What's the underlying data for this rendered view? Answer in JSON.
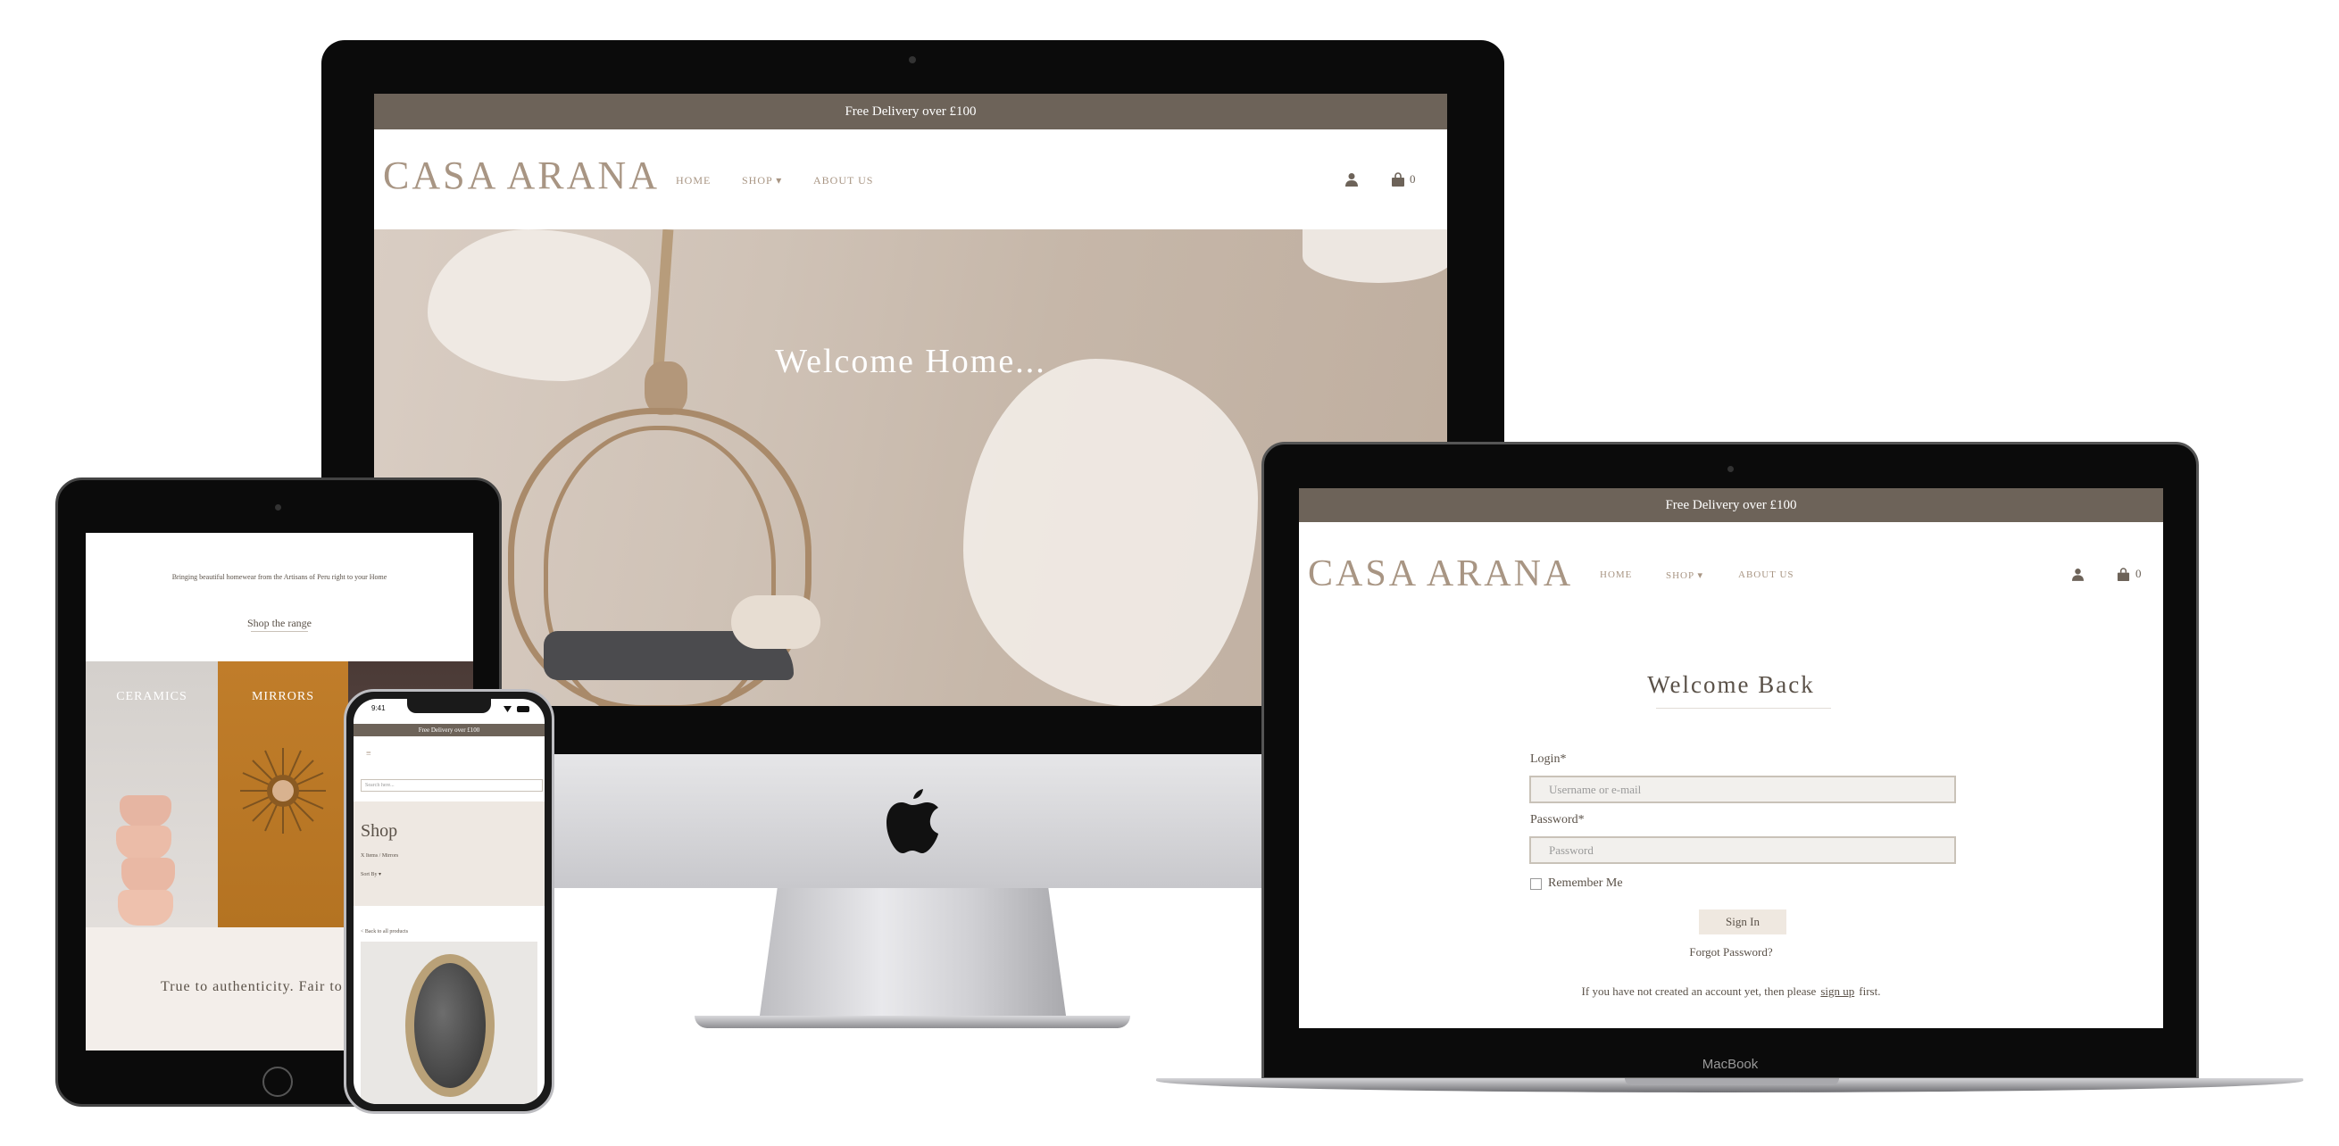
{
  "desktop": {
    "top_banner": "Free Delivery over £100",
    "logo": "CASA ARANA",
    "nav": {
      "home": "HOME",
      "shop": "SHOP",
      "about": "ABOUT US"
    },
    "cart_count": "0",
    "hero_title": "Welcome Home..."
  },
  "laptop": {
    "top_banner": "Free Delivery over £100",
    "logo": "CASA ARANA",
    "nav": {
      "home": "HOME",
      "shop": "SHOP",
      "about": "ABOUT US"
    },
    "cart_count": "0",
    "heading": "Welcome Back",
    "login_label": "Login*",
    "login_placeholder": "Username or e-mail",
    "password_label": "Password*",
    "password_placeholder": "Password",
    "remember_label": "Remember Me",
    "signin_button": "Sign In",
    "forgot_link": "Forgot Password?",
    "signup_text_before": "If you have not created an account yet, then please",
    "signup_link": "sign up",
    "signup_text_after": "first.",
    "brand_label": "MacBook"
  },
  "tablet": {
    "tagline": "Bringing beautiful homewear from the Artisans of Peru right to your Home",
    "shop_range": "Shop the range",
    "cat_ceramics": "CERAMICS",
    "cat_mirrors": "MIRRORS",
    "authenticity": "True to authenticity. Fair to t"
  },
  "phone": {
    "time": "9:41",
    "top_banner": "Free Delivery over £100",
    "search_placeholder": "Search here...",
    "shop_title": "Shop",
    "breadcrumb": "X Items / Mirrors",
    "sort_label": "Sort By",
    "back_link": "< Back to all products"
  },
  "colors": {
    "brand": "#a89583",
    "banner": "#6d6359",
    "field_bg": "#f2f0ed"
  }
}
